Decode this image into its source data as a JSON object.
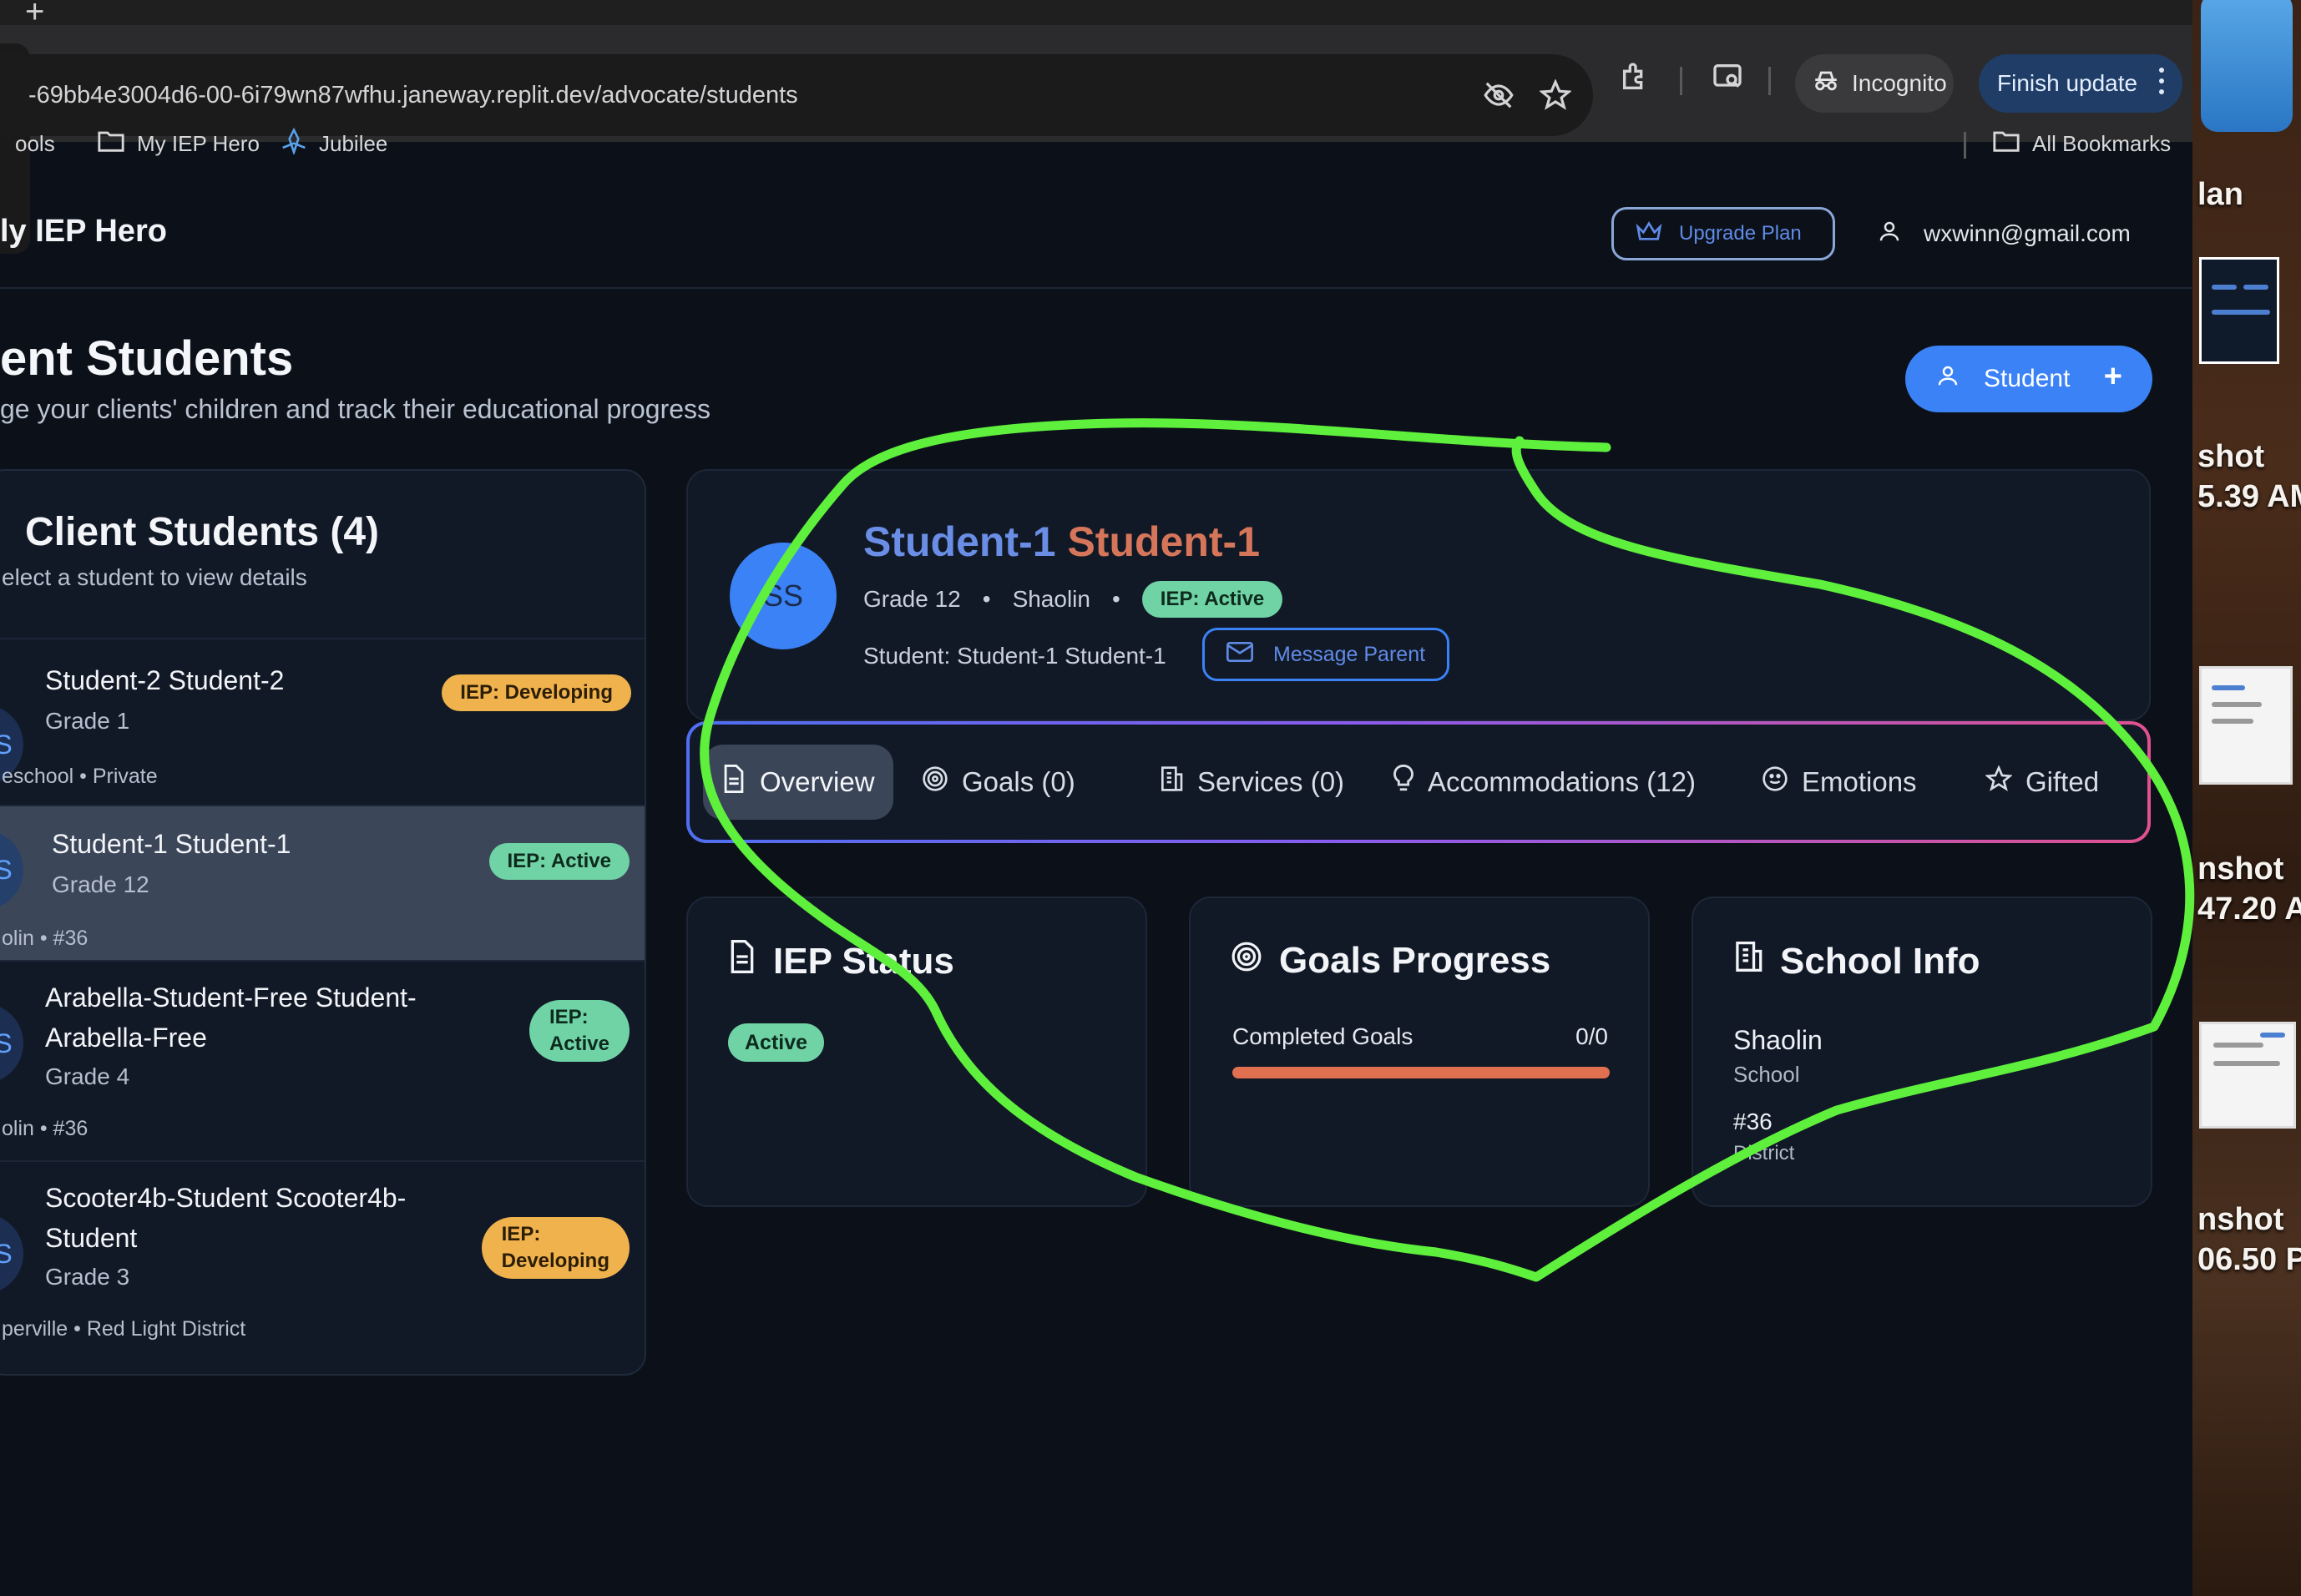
{
  "browser": {
    "new_tab_symbol": "+",
    "url": "-69bb4e3004d6-00-6i79wn87wfhu.janeway.replit.dev/advocate/students",
    "incognito_label": "Incognito",
    "finish_update_label": "Finish update",
    "bookmarks": [
      {
        "label": "ools",
        "icon": "none"
      },
      {
        "label": "My IEP Hero",
        "icon": "folder-icon"
      },
      {
        "label": "Jubilee",
        "icon": "jubilee-icon"
      }
    ],
    "all_bookmarks_label": "All Bookmarks"
  },
  "app": {
    "brand": "ly IEP Hero",
    "upgrade_label": "Upgrade Plan",
    "user_email": "wxwinn@gmail.com"
  },
  "page": {
    "title": "ent Students",
    "subtitle": "ge your clients' children and track their educational progress",
    "add_button_label": "Student",
    "add_button_plus": "+"
  },
  "sidebar": {
    "title": "Client Students (4)",
    "subtitle": "elect a student to view details",
    "students": [
      {
        "initials": "S",
        "name": "Student-2 Student-2",
        "grade": "Grade 1",
        "meta": "eschool • Private",
        "badge": "IEP: Developing",
        "status": "developing",
        "selected": false
      },
      {
        "initials": "S",
        "name": "Student-1 Student-1",
        "grade": "Grade 12",
        "meta": "olin • #36",
        "badge": "IEP: Active",
        "status": "active",
        "selected": true
      },
      {
        "initials": "S",
        "name_line1": "Arabella-Student-Free Student-",
        "name_line2": "Arabella-Free",
        "grade": "Grade 4",
        "meta": "olin • #36",
        "badge_line1": "IEP:",
        "badge_line2": "Active",
        "status": "active",
        "selected": false
      },
      {
        "initials": "S",
        "name_line1": "Scooter4b-Student Scooter4b-",
        "name_line2": "Student",
        "grade": "Grade 3",
        "meta": "perville • Red Light District",
        "badge_line1": "IEP:",
        "badge_line2": "Developing",
        "status": "developing",
        "selected": false
      }
    ]
  },
  "detail": {
    "initials": "SS",
    "first_name": "Student-1",
    "last_name": "Student-1",
    "grade": "Grade 12",
    "school": "Shaolin",
    "iep_badge": "IEP: Active",
    "student_line": "Student: Student-1 Student-1",
    "message_parent_label": "Message Parent",
    "tabs": [
      {
        "label": "Overview",
        "icon": "document-icon",
        "active": true
      },
      {
        "label": "Goals  (0)",
        "icon": "target-icon",
        "active": false
      },
      {
        "label": "Services  (0)",
        "icon": "building-icon",
        "active": false
      },
      {
        "label": "Accommodations  (12)",
        "icon": "lightbulb-icon",
        "active": false
      },
      {
        "label": "Emotions",
        "icon": "smile-icon",
        "active": false
      },
      {
        "label": "Gifted",
        "icon": "star-icon",
        "active": false
      }
    ],
    "iep_status": {
      "title": "IEP Status",
      "value": "Active"
    },
    "goals_progress": {
      "title": "Goals Progress",
      "label": "Completed Goals",
      "value": "0/0",
      "completed": 0,
      "total": 0
    },
    "school_info": {
      "title": "School Info",
      "school_name": "Shaolin",
      "school_label": "School",
      "district_number": "#36",
      "district_label": "District"
    }
  },
  "desktop": {
    "labels": [
      "lan",
      "shot",
      "5.39 AM",
      "nshot",
      "47.20 A",
      "nshot",
      "06.50 P"
    ]
  },
  "colors": {
    "accent": "#3b82f6",
    "active_badge": "#6fd3a5",
    "developing_badge": "#f0b24d",
    "progress_bar": "#e0704f",
    "annotation": "#5ef03c"
  }
}
